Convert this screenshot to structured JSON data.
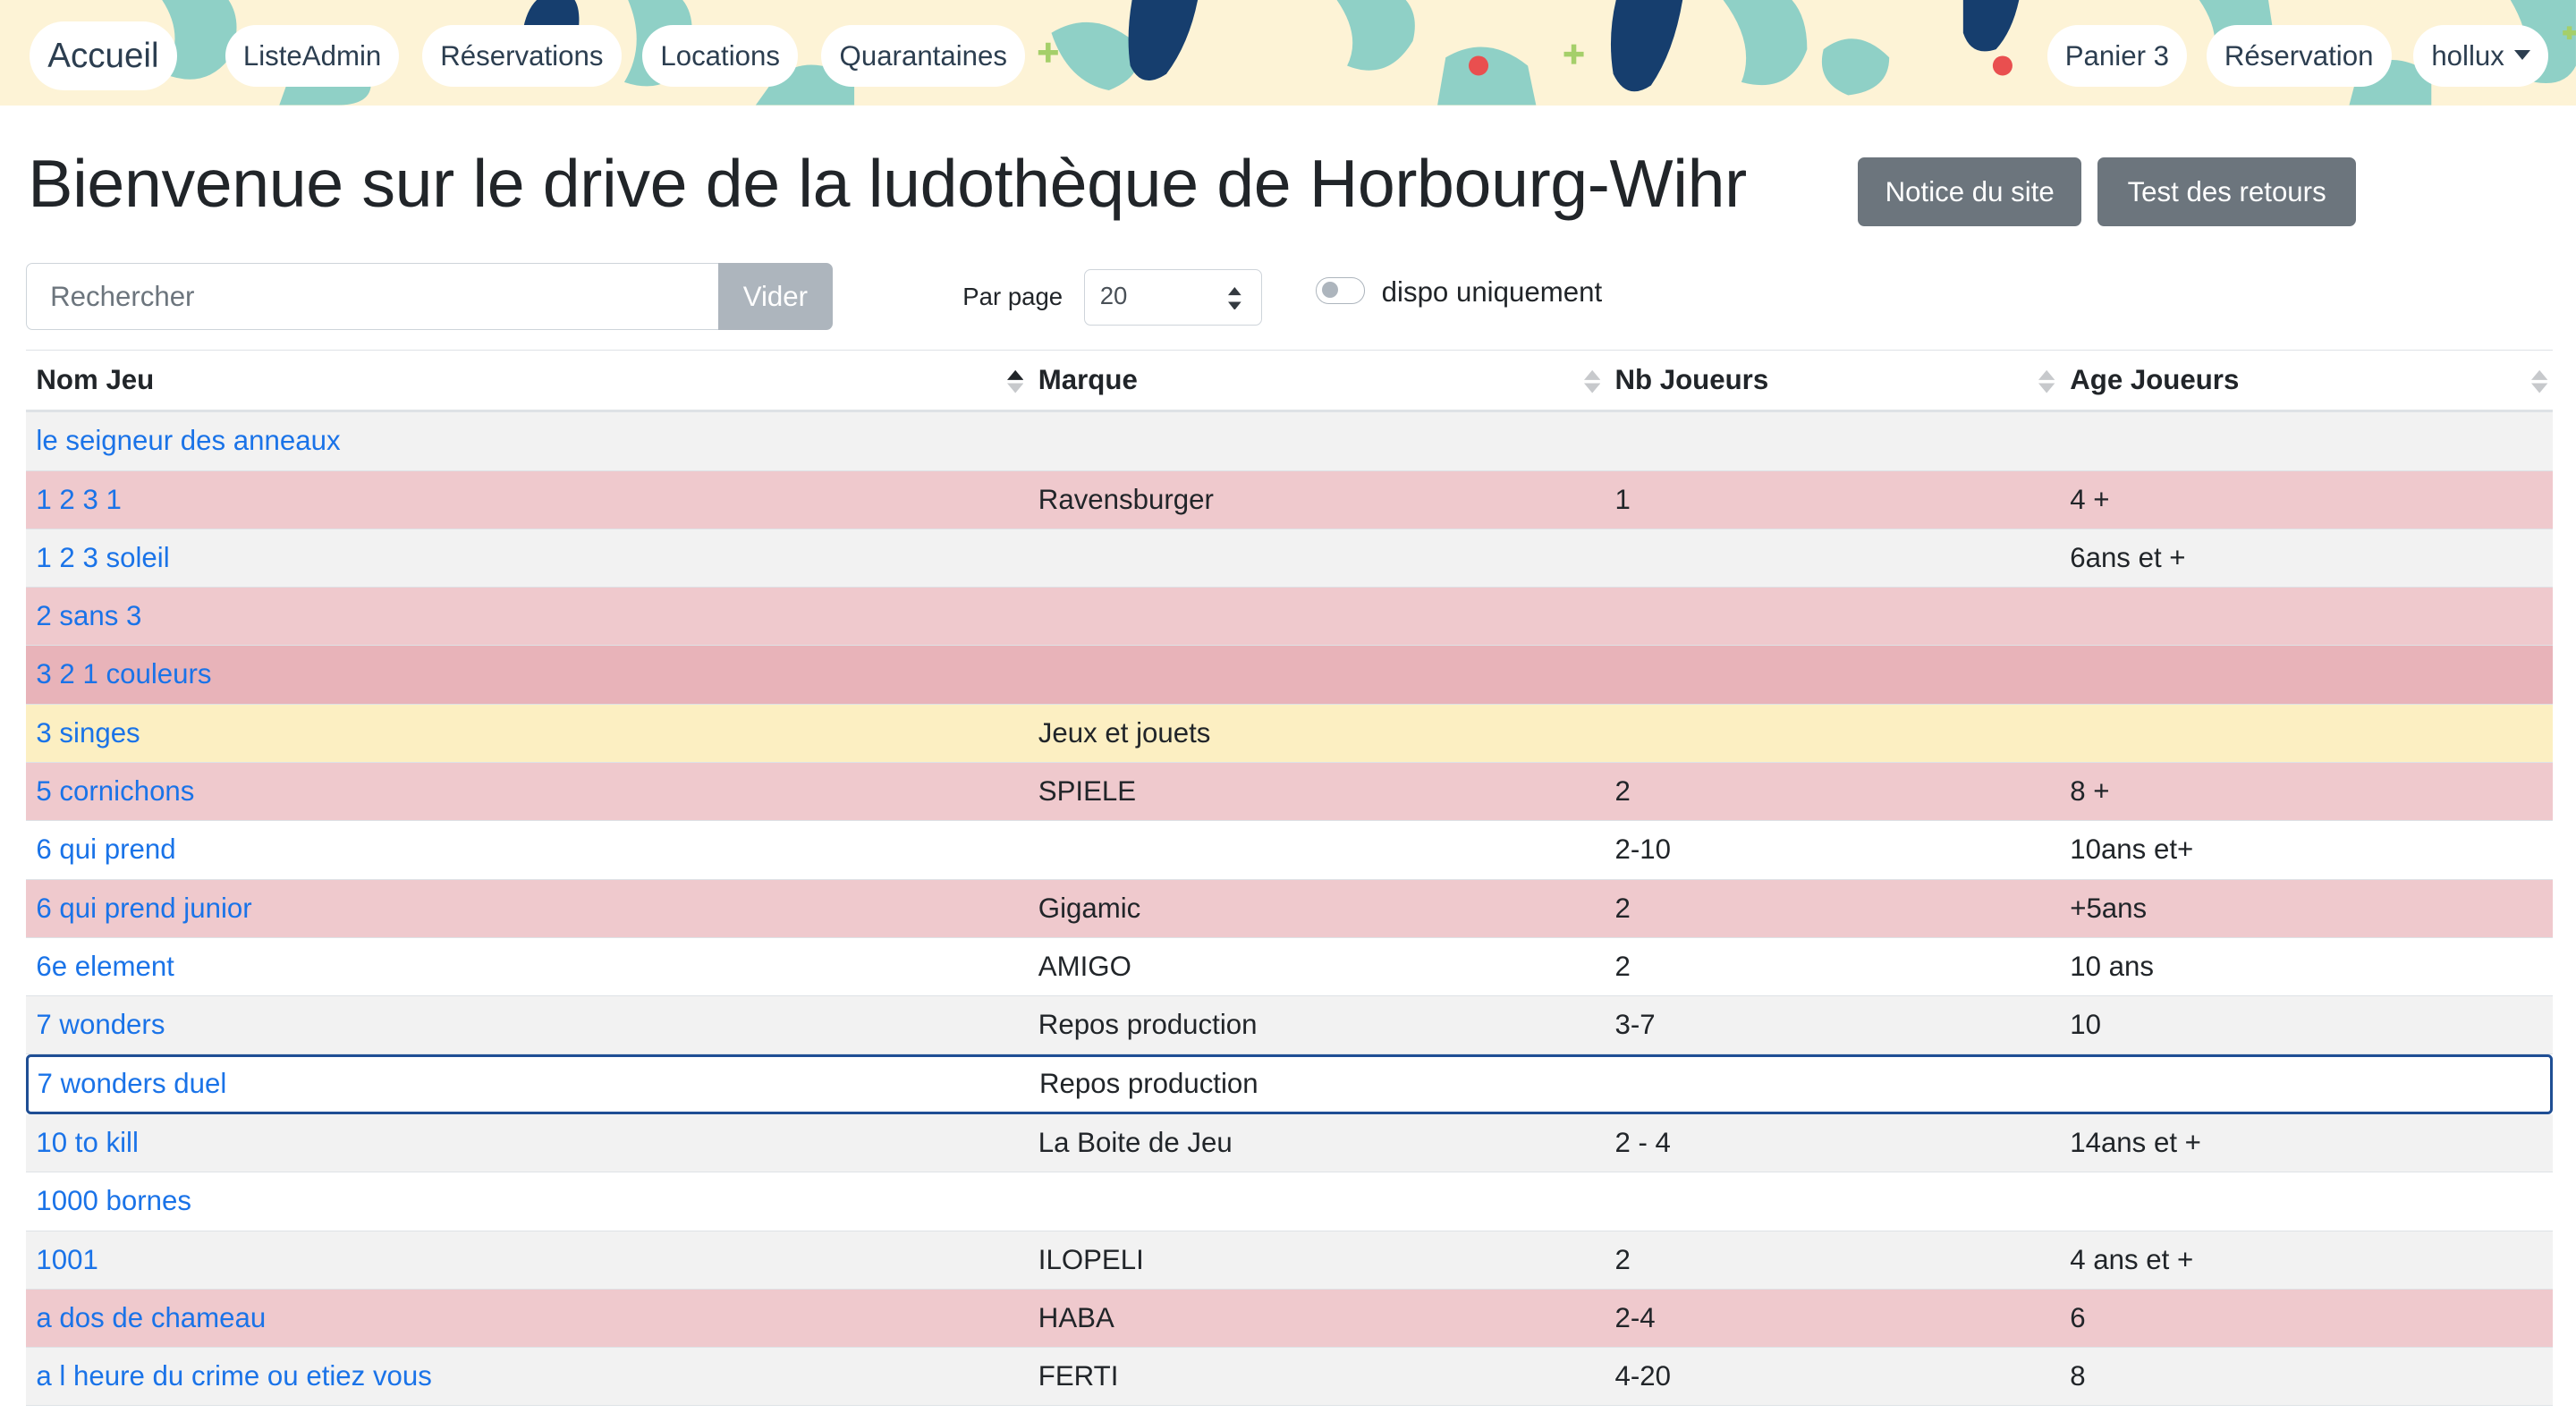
{
  "nav": {
    "brand": "Accueil",
    "left_items": [
      "ListeAdmin",
      "Réservations",
      "Locations",
      "Quarantaines"
    ],
    "cart": "Panier 3",
    "reservation": "Réservation",
    "user": "hollux"
  },
  "header": {
    "title": "Bienvenue sur le drive de la ludothèque de Horbourg-Wihr",
    "notice_button": "Notice du site",
    "test_button": "Test des retours"
  },
  "controls": {
    "search_placeholder": "Rechercher",
    "clear_button": "Vider",
    "per_page_label": "Par page",
    "per_page_value": "20",
    "toggle_label": "dispo uniquement"
  },
  "table": {
    "columns": [
      "Nom Jeu",
      "Marque",
      "Nb Joueurs",
      "Age Joueurs"
    ],
    "rows": [
      {
        "name": "le seigneur des anneaux",
        "brand": "",
        "players": "",
        "age": "",
        "status": "default"
      },
      {
        "name": "1 2 3 1",
        "brand": "Ravensburger",
        "players": "1",
        "age": "4 +",
        "status": "unavailable"
      },
      {
        "name": "1 2 3 soleil",
        "brand": "",
        "players": "",
        "age": "6ans et +",
        "status": "default"
      },
      {
        "name": "2 sans 3",
        "brand": "",
        "players": "",
        "age": "",
        "status": "unavailable"
      },
      {
        "name": "3 2 1 couleurs",
        "brand": "",
        "players": "",
        "age": "",
        "status": "unavailable-dark"
      },
      {
        "name": "3 singes",
        "brand": "Jeux et jouets",
        "players": "",
        "age": "",
        "status": "reserved"
      },
      {
        "name": "5 cornichons",
        "brand": "SPIELE",
        "players": "2",
        "age": "8 +",
        "status": "unavailable"
      },
      {
        "name": "6 qui prend",
        "brand": "",
        "players": "2-10",
        "age": "10ans et+",
        "status": "white"
      },
      {
        "name": "6 qui prend junior",
        "brand": "Gigamic",
        "players": "2",
        "age": "+5ans",
        "status": "unavailable"
      },
      {
        "name": "6e element",
        "brand": "AMIGO",
        "players": "2",
        "age": "10 ans",
        "status": "white"
      },
      {
        "name": "7 wonders",
        "brand": "Repos production",
        "players": "3-7",
        "age": "10",
        "status": "default"
      },
      {
        "name": "7 wonders duel",
        "brand": "Repos production",
        "players": "",
        "age": "",
        "status": "selected"
      },
      {
        "name": "10 to kill",
        "brand": "La Boite de Jeu",
        "players": "2 - 4",
        "age": "14ans et +",
        "status": "default"
      },
      {
        "name": "1000 bornes",
        "brand": "",
        "players": "",
        "age": "",
        "status": "white"
      },
      {
        "name": "1001",
        "brand": "ILOPELI",
        "players": "2",
        "age": "4 ans et +",
        "status": "default"
      },
      {
        "name": "a dos de chameau",
        "brand": "HABA",
        "players": "2-4",
        "age": "6",
        "status": "unavailable"
      },
      {
        "name": "a l heure du crime ou etiez vous",
        "brand": "FERTI",
        "players": "4-20",
        "age": "8",
        "status": "default"
      }
    ]
  },
  "colors": {
    "link": "#1a73e8",
    "unavailable": "#efc9cd",
    "unavailable-dark": "#e8b3b9",
    "reserved": "#fcefc2",
    "default": "#f2f2f2",
    "white": "#ffffff",
    "selected": "#ffffff",
    "nav_bg": "#fdf3d6",
    "deco_navy": "#163e6e",
    "deco_teal": "#8fd0c6",
    "deco_red": "#e94f4f"
  }
}
